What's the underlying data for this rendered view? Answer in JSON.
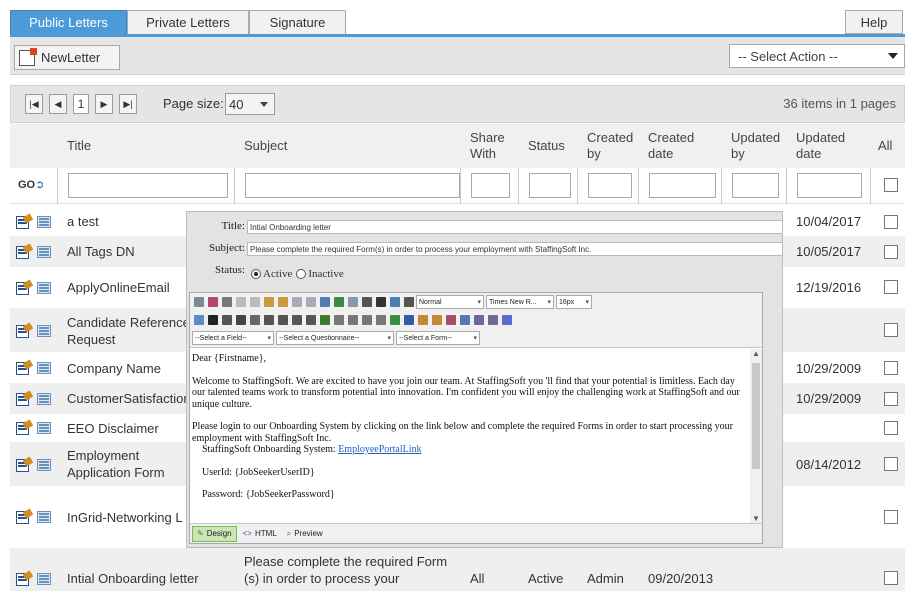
{
  "tabs": [
    {
      "label": "Public Letters",
      "active": true
    },
    {
      "label": "Private Letters",
      "active": false
    },
    {
      "label": "Signature",
      "active": false
    }
  ],
  "help_label": "Help",
  "toolbar": {
    "new_letter": "NewLetter",
    "select_action": "-- Select Action --"
  },
  "pager": {
    "current_page": "1",
    "page_size_label": "Page size:",
    "page_size": "40",
    "items_info": "36 items in 1 pages"
  },
  "columns": {
    "title": "Title",
    "subject": "Subject",
    "share_with": "Share With",
    "status": "Status",
    "created_by": "Created by",
    "created_date": "Created date",
    "updated_by": "Updated by",
    "updated_date": "Updated date",
    "all": "All"
  },
  "filter": {
    "go_label": "GO"
  },
  "rows": [
    {
      "title": "a test",
      "subject": "",
      "share_with": "",
      "status": "",
      "created_by": "",
      "created_date": "",
      "updated_by": "",
      "updated_date": "10/04/2017"
    },
    {
      "title": "All Tags DN",
      "subject": "",
      "share_with": "",
      "status": "",
      "created_by": "",
      "created_date": "",
      "updated_by": "",
      "updated_date": "10/05/2017"
    },
    {
      "title": "ApplyOnlineEmail",
      "subject": "",
      "share_with": "",
      "status": "",
      "created_by": "",
      "created_date": "",
      "updated_by": "",
      "updated_date": "12/19/2016"
    },
    {
      "title": "Candidate Reference Request",
      "subject": "",
      "share_with": "",
      "status": "",
      "created_by": "",
      "created_date": "",
      "updated_by": "",
      "updated_date": ""
    },
    {
      "title": "Company Name",
      "subject": "",
      "share_with": "",
      "status": "",
      "created_by": "",
      "created_date": "",
      "updated_by": "",
      "updated_date": "10/29/2009"
    },
    {
      "title": "CustomerSatisfaction",
      "subject": "",
      "share_with": "",
      "status": "",
      "created_by": "",
      "created_date": "",
      "updated_by": "",
      "updated_date": "10/29/2009"
    },
    {
      "title": "EEO Disclaimer",
      "subject": "",
      "share_with": "",
      "status": "",
      "created_by": "",
      "created_date": "",
      "updated_by": "",
      "updated_date": ""
    },
    {
      "title": "Employment Application Form Request",
      "subject": "",
      "share_with": "",
      "status": "",
      "created_by": "",
      "created_date": "",
      "updated_by": "",
      "updated_date": "08/14/2012"
    },
    {
      "title": "InGrid-Networking L",
      "subject": "",
      "share_with": "",
      "status": "",
      "created_by": "",
      "created_date": "",
      "updated_by": "",
      "updated_date": ""
    },
    {
      "title": "Intial Onboarding letter",
      "subject": "Please complete the required Form (s) in order to process your",
      "share_with": "All",
      "status": "Active",
      "created_by": "Admin",
      "created_date": "09/20/2013",
      "updated_by": "",
      "updated_date": ""
    }
  ],
  "popup": {
    "title_label": "Title:",
    "title_value": "Intial Onboarding letter",
    "subject_label": "Subject:",
    "subject_value": "Please complete the required Form(s) in order to process your employment with StaffingSoft Inc.",
    "status_label": "Status:",
    "status_active": "Active",
    "status_inactive": "Inactive",
    "format_select": "Normal",
    "font_select": "Times New R...",
    "size_select": "16px",
    "field_select": "--Select a Field--",
    "questionnaire_select": "--Select a Questionnaire--",
    "form_select": "--Select a Form--",
    "body": {
      "greeting": "Dear {Firstname},",
      "p1": "Welcome to StaffingSoft. We are excited to have you join our team.  At StaffingSoft you 'll find that your potential is limitless.  Each day our talented teams work to transform potential into innovation.  I'm confident you will enjoy the challenging work at StaffingSoft and our unique culture.",
      "p2": "Please login to our Onboarding System by clicking on the link below and complete the required Forms in order to start processing your employment with StaffingSoft Inc.",
      "system_label": "StaffingSoft Onboarding System:",
      "system_link": "EmployeePortalLink",
      "userid": "UserId: {JobSeekerUserID}",
      "password": "Password: {JobSeekerPassword}"
    },
    "modes": {
      "design": "Design",
      "html": "HTML",
      "preview": "Preview"
    }
  },
  "colors": {
    "accent": "#4d9ad8",
    "alt_row": "#efefef",
    "link": "#1d5fbd"
  }
}
